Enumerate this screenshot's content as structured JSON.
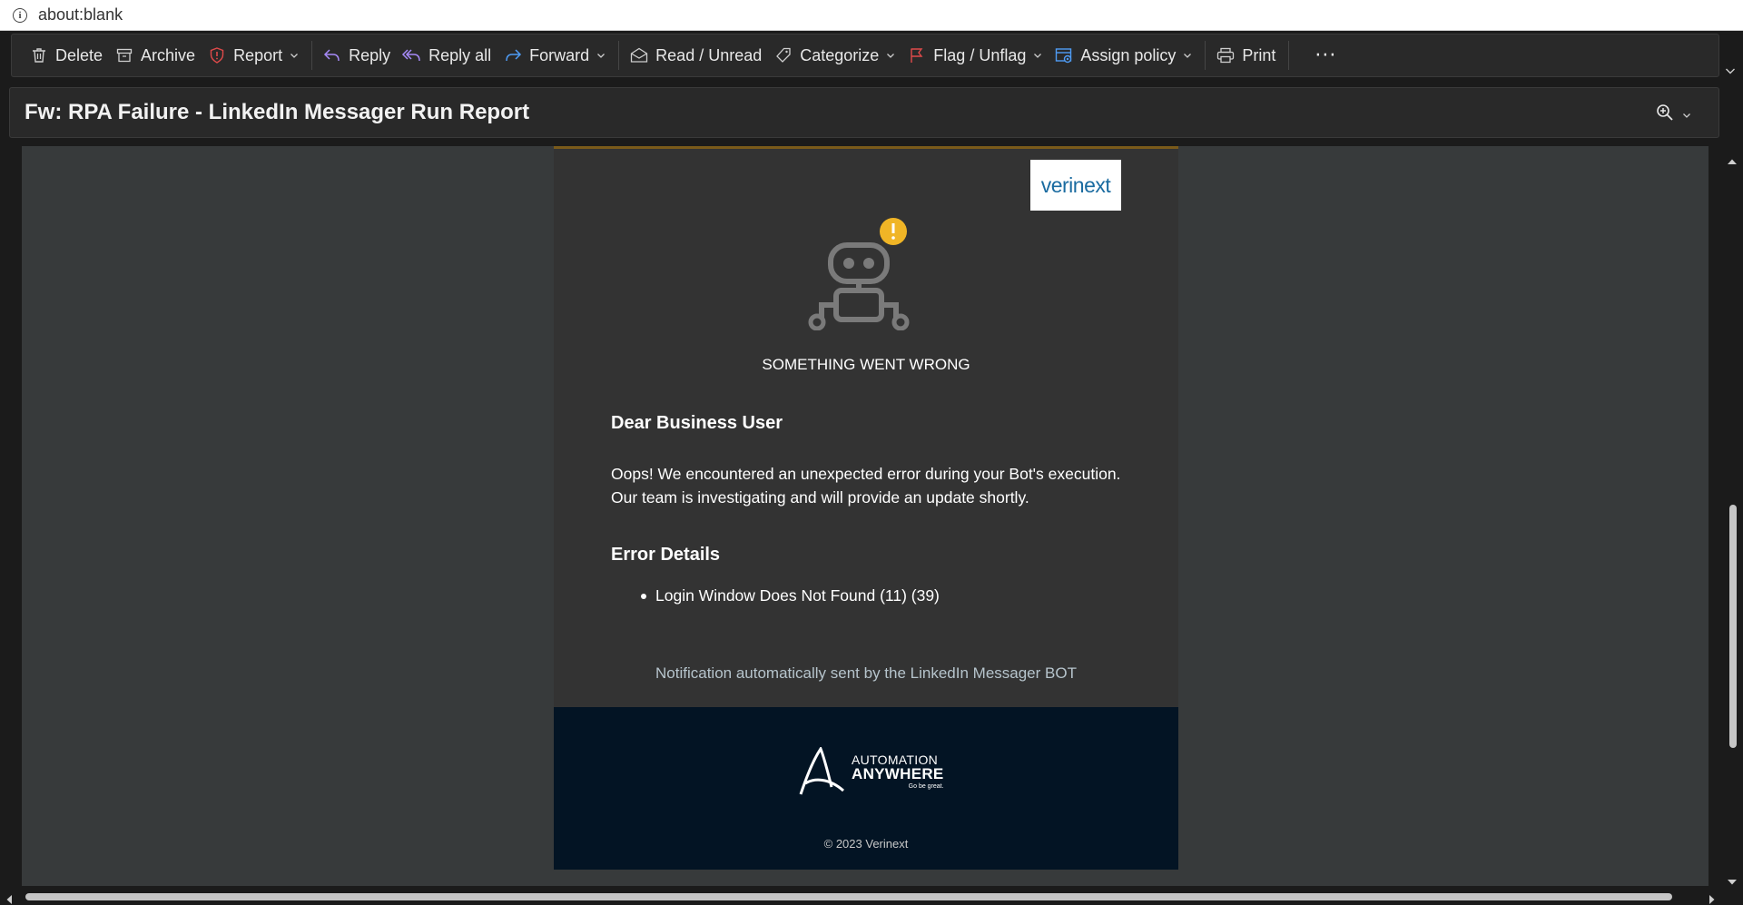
{
  "address_bar": {
    "url": "about:blank",
    "icon": "info-icon"
  },
  "toolbar": {
    "items": [
      {
        "label": "Delete",
        "icon": "trash-icon"
      },
      {
        "label": "Archive",
        "icon": "archive-icon"
      },
      {
        "label": "Report",
        "icon": "shield-alert-icon"
      },
      {
        "label": "Reply",
        "icon": "reply-icon"
      },
      {
        "label": "Reply all",
        "icon": "reply-all-icon"
      },
      {
        "label": "Forward",
        "icon": "forward-icon"
      },
      {
        "label": "Read / Unread",
        "icon": "envelope-open-icon"
      },
      {
        "label": "Categorize",
        "icon": "tag-icon"
      },
      {
        "label": "Flag / Unflag",
        "icon": "flag-icon"
      },
      {
        "label": "Assign policy",
        "icon": "policy-icon"
      },
      {
        "label": "Print",
        "icon": "printer-icon"
      }
    ],
    "more_label": "···"
  },
  "subject": {
    "title": "Fw: RPA Failure - LinkedIn Messager Run Report"
  },
  "email": {
    "brand_logo": "verinext",
    "error_title": "SOMETHING WENT WRONG",
    "greeting": "Dear Business User",
    "message_line1": "Oops! We encountered an unexpected error during your Bot's execution.",
    "message_line2": "Our team is investigating and will provide an update shortly.",
    "error_heading": "Error Details",
    "errors": [
      "Login Window Does Not Found (11) (39)"
    ],
    "notice": "Notification automatically sent by the LinkedIn Messager BOT",
    "footer_logo_line1": "AUTOMATION",
    "footer_logo_line2": "ANYWHERE",
    "footer_logo_tagline": "Go be great.",
    "copyright": "© 2023 Verinext"
  },
  "colors": {
    "toolbar_bg": "#292929",
    "pane_bg": "#373a3b",
    "card_bg": "#333333",
    "footer_bg": "#031424",
    "accent_blue": "#4f9cf5",
    "alert_yellow": "#f0b526",
    "flag_red": "#e04a4a"
  }
}
